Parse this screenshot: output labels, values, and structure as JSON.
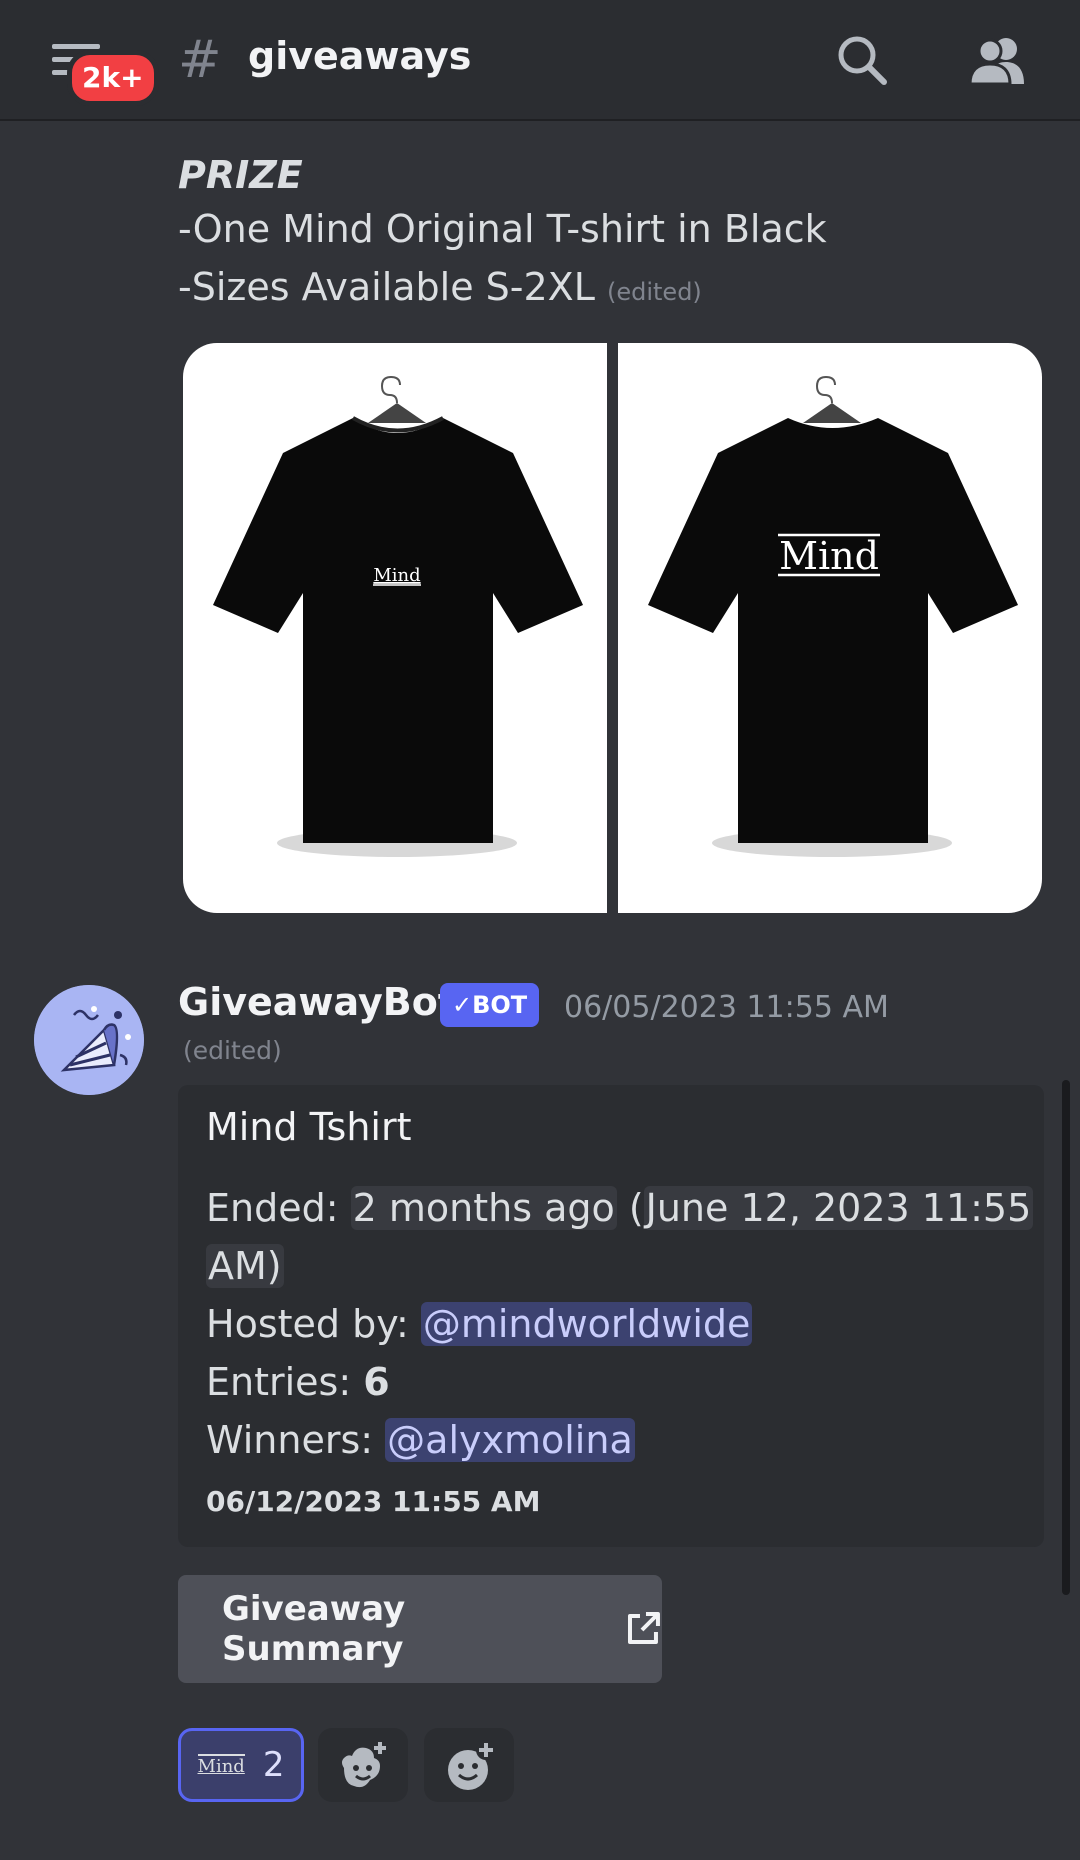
{
  "header": {
    "badge": "2k+",
    "channel_hash": "#",
    "channel_name": "giveaways",
    "icons": [
      "hamburger-menu-icon",
      "search-icon",
      "members-icon"
    ]
  },
  "prize": {
    "title": "PRIZE",
    "line1": "-One Mind Original T-shirt in Black",
    "line2": "-Sizes Available S-2XL",
    "edited": "(edited)"
  },
  "images": {
    "left_logo": "Mind",
    "right_logo": "Mind"
  },
  "bot_message": {
    "author": "GiveawayBot",
    "tag": "✓BOT",
    "timestamp": "06/05/2023 11:55 AM",
    "edited": "(edited)"
  },
  "embed": {
    "title": "Mind Tshirt",
    "ended_label": "Ended: ",
    "ended_relative": "2 months ago",
    "ended_open": " (",
    "ended_date": "June 12, 2023 11:55",
    "ended_tail": "AM)",
    "hosted_label": "Hosted by: ",
    "host": "@mindworldwide",
    "entries_label": "Entries: ",
    "entries": "6",
    "winners_label": "Winners: ",
    "winner": "@alyxmolina",
    "footer": "06/12/2023 11:55 AM"
  },
  "summary_button": {
    "label": "Giveaway Summary",
    "icon": "external-link-icon"
  },
  "reactions": {
    "emoji_label": "Mind",
    "count": "2",
    "add_icons": [
      "add-super-reaction-icon",
      "add-reaction-icon"
    ]
  },
  "colors": {
    "background": "#313338",
    "header": "#2b2d31",
    "accent": "#5865f2",
    "badge": "#f23f43",
    "mention_bg": "#3c4270"
  }
}
